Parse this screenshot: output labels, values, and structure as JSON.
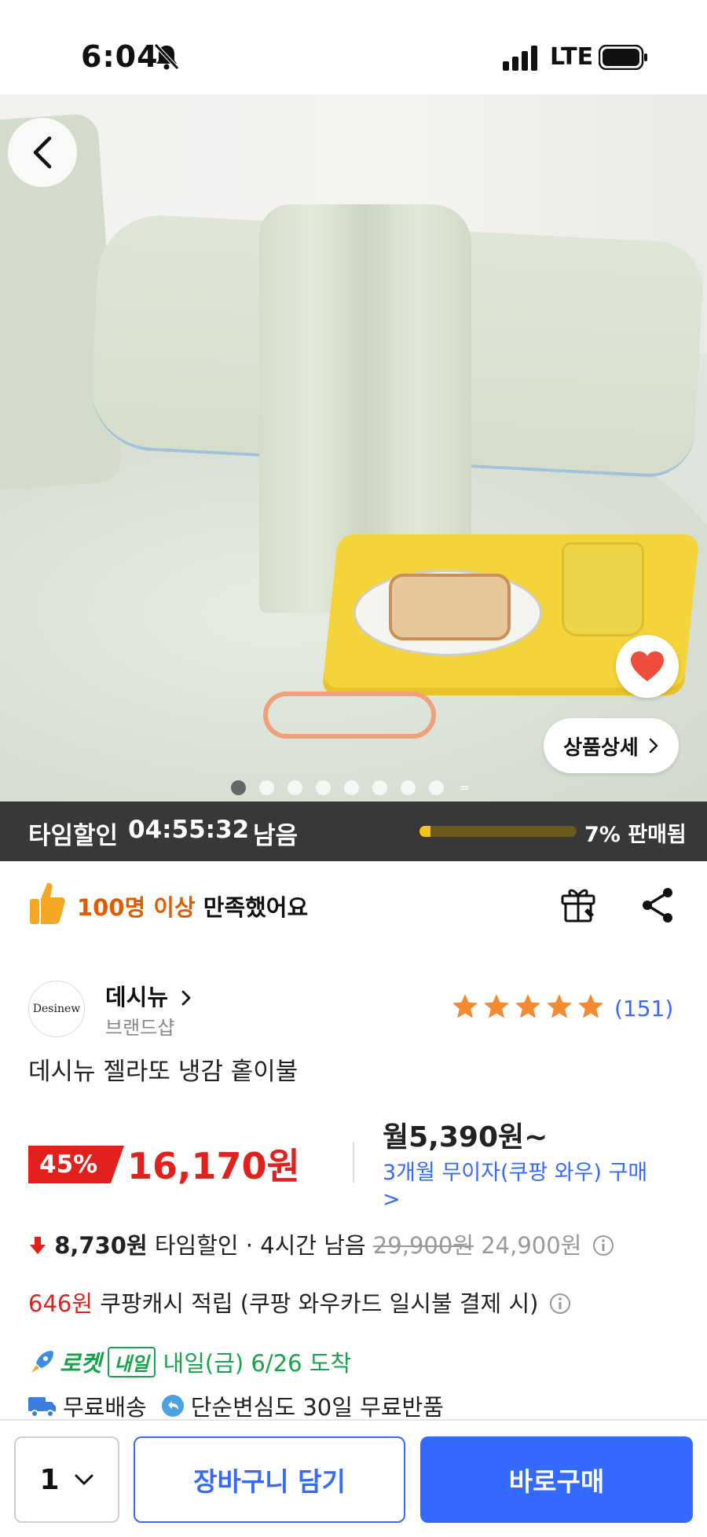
{
  "status_bar": {
    "time": "6:04",
    "network": "LTE",
    "icons": [
      "bell-off-icon",
      "signal-icon",
      "battery-icon"
    ]
  },
  "hero": {
    "image_alt": "product-photo",
    "detail_button_label": "상품상세",
    "carousel": {
      "total_dots": 8,
      "active_index": 0
    },
    "icons": [
      "back-chevron-icon",
      "heart-icon",
      "chevron-right-icon"
    ]
  },
  "time_sale": {
    "label": "타임할인",
    "countdown": "04:55:32",
    "remain_label": "남음",
    "sold_percent": 7,
    "sold_label": "7% 판매됨",
    "colors": {
      "bar_bg": "#383838",
      "fill": "#f5c518"
    }
  },
  "satisfaction": {
    "highlight": "100명 이상",
    "text": " 만족했어요",
    "icons": [
      "thumbs-up-icon",
      "gift-icon",
      "share-icon"
    ]
  },
  "seller": {
    "logo_text": "Desinew",
    "name": "데시뉴",
    "subtitle": "브랜드샵",
    "rating_stars": 5,
    "review_count": "(151)"
  },
  "product": {
    "title": "데시뉴 젤라또 냉감 홑이불"
  },
  "price": {
    "discount": "45%",
    "sale_price": "16,170원",
    "monthly": "월5,390원~",
    "installment": "3개월 무이자(쿠팡 와우) 구매",
    "installment_chevron": ">",
    "timesale_amount": "8,730원",
    "timesale_text": " 타임할인 · 4시간 남음 ",
    "original_price": "29,900원",
    "before_timesale_price": " 24,900원"
  },
  "cashback": {
    "amount": "646원",
    "text": " 쿠팡캐시 적립 (쿠팡 와우카드 일시불 결제 시)"
  },
  "delivery": {
    "rocket_label": "로켓",
    "badge": "내일",
    "arrival": "내일(금) 6/26 도착",
    "free_shipping": "무료배송",
    "free_return": "단순변심도 30일 무료반품"
  },
  "bottom_bar": {
    "quantity": "1",
    "cart_label": "장바구니 담기",
    "buy_label": "바로구매",
    "colors": {
      "primary": "#346aff"
    }
  }
}
